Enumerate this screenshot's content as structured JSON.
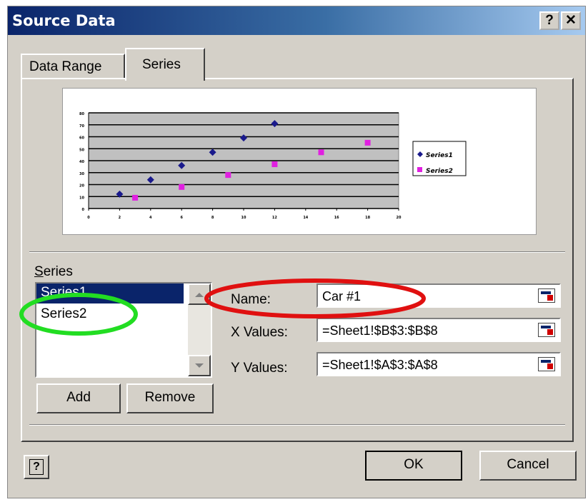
{
  "window": {
    "title": "Source Data",
    "help_glyph": "?",
    "close_glyph": "✕"
  },
  "tabs": [
    {
      "label": "Data Range",
      "active": false
    },
    {
      "label": "Series",
      "active": true
    }
  ],
  "chart_data": {
    "type": "scatter",
    "title": "",
    "xlabel": "",
    "ylabel": "",
    "xlim": [
      0,
      20
    ],
    "ylim": [
      0,
      80
    ],
    "x_ticks": [
      0,
      2,
      4,
      6,
      8,
      10,
      12,
      14,
      16,
      18,
      20
    ],
    "y_ticks": [
      0,
      10,
      20,
      30,
      40,
      50,
      60,
      70,
      80
    ],
    "grid": true,
    "legend_position": "right",
    "series": [
      {
        "name": "Series1",
        "color": "#1a1a8c",
        "marker": "diamond",
        "points": [
          [
            2,
            12
          ],
          [
            4,
            24
          ],
          [
            6,
            36
          ],
          [
            8,
            47
          ],
          [
            10,
            59
          ],
          [
            12,
            71
          ]
        ]
      },
      {
        "name": "Series2",
        "color": "#e020e0",
        "marker": "square",
        "points": [
          [
            3,
            9
          ],
          [
            6,
            18
          ],
          [
            9,
            28
          ],
          [
            12,
            37
          ],
          [
            15,
            47
          ],
          [
            18,
            55
          ]
        ]
      }
    ]
  },
  "series_panel": {
    "label": "Series",
    "items": [
      {
        "label": "Series1",
        "selected": true
      },
      {
        "label": "Series2",
        "selected": false
      }
    ],
    "add_label": "Add",
    "remove_label": "Remove"
  },
  "fields": {
    "name_label": "Name:",
    "name_value": "Car #1",
    "x_label": "X Values:",
    "x_value": "=Sheet1!$B$3:$B$8",
    "y_label": "Y Values:",
    "y_value": "=Sheet1!$A$3:$A$8"
  },
  "footer": {
    "ok_label": "OK",
    "cancel_label": "Cancel",
    "help_glyph": "?"
  },
  "colors": {
    "title_gradient_start": "#0a246a",
    "dialog_face": "#d4d0c8",
    "selection": "#0a246a",
    "annotation_red": "#e01010",
    "annotation_green": "#22dd22"
  }
}
